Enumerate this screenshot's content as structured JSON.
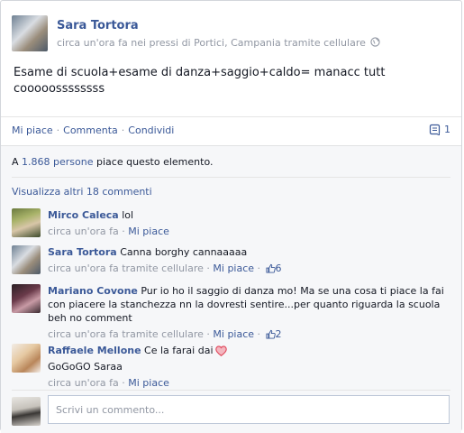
{
  "post": {
    "author": "Sara Tortora",
    "meta": "circa un'ora fa nei pressi di Portici, Campania tramite cellulare",
    "text": "Esame di scuola+esame di danza+saggio+caldo= manacc tutt cooooossssssss"
  },
  "actions": {
    "like": "Mi piace",
    "comment": "Commenta",
    "share": "Condividi",
    "separator": "·",
    "comment_count": "1"
  },
  "likes": {
    "prefix": "A",
    "count_link": "1.868 persone",
    "suffix": "piace questo elemento."
  },
  "more_comments": "Visualizza altri 18 commenti",
  "comments": [
    {
      "name": "Mirco Caleca",
      "text": "lol",
      "time": "circa un'ora fa",
      "like": "Mi piace",
      "like_count": ""
    },
    {
      "name": "Sara Tortora",
      "text": "Canna borghy cannaaaaa",
      "time": "circa un'ora fa tramite cellulare",
      "like": "Mi piace",
      "like_count": "6"
    },
    {
      "name": "Mariano Covone",
      "text": "Pur io ho il saggio di danza mo! Ma se una cosa ti piace la fai con piacere la stanchezza nn la dovresti sentire...per quanto riguarda la scuola beh no comment",
      "time": "circa un'ora fa tramite cellulare",
      "like": "Mi piace",
      "like_count": "2"
    },
    {
      "name": "Raffaele Mellone",
      "text": "Ce la farai dai",
      "text2": "GoGoGO Saraa",
      "time": "circa un'ora fa",
      "like": "Mi piace",
      "like_count": ""
    }
  ],
  "composer": {
    "placeholder": "Scrivi un commento..."
  },
  "colors": {
    "link": "#3b5998",
    "muted": "#9197a3",
    "heart": "#e0475b"
  }
}
